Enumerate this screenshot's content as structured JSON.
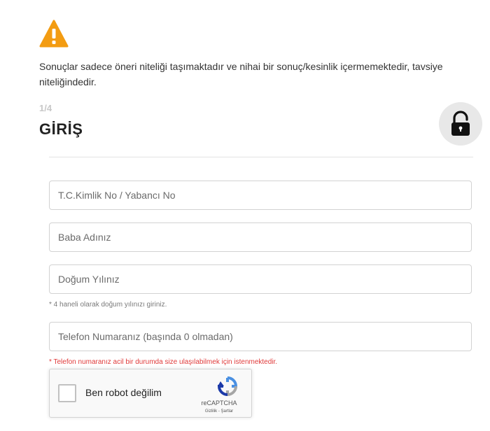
{
  "notice": {
    "text": "Sonuçlar sadece öneri niteliği taşımaktadır ve nihai bir sonuç/kesinlik içermemektedir, tavsiye niteliğindedir.",
    "icon": "warning-icon",
    "icon_color": "#f39c12"
  },
  "header": {
    "step": "1/4",
    "title": "GİRİŞ",
    "icon": "lock-icon"
  },
  "form": {
    "tc_placeholder": "T.C.Kimlik No / Yabancı No",
    "father_placeholder": "Baba Adınız",
    "birth_year_placeholder": "Doğum Yılınız",
    "birth_year_hint": "* 4 haneli olarak doğum yılınızı giriniz.",
    "phone_placeholder": "Telefon Numaranız (başında 0 olmadan)",
    "phone_hint": "* Telefon numaranız acil bir durumda size ulaşılabilmek için istenmektedir.",
    "phone_hint_color": "#e03a3a"
  },
  "recaptcha": {
    "label": "Ben robot değilim",
    "brand": "reCAPTCHA",
    "terms": "Gizlilik - Şartlar",
    "icon": "recaptcha-logo-icon"
  }
}
